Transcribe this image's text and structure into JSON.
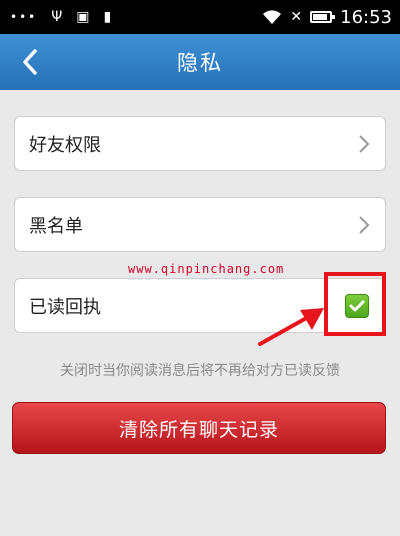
{
  "status_bar": {
    "time": "16:53",
    "icons": [
      "dots-icon",
      "usb-icon",
      "notification-icon",
      "sd-card-icon",
      "wifi-icon",
      "no-signal-icon",
      "battery-icon"
    ]
  },
  "header": {
    "title": "隐私",
    "back_icon": "chevron-left-icon"
  },
  "rows": [
    {
      "label": "好友权限",
      "trailing": "chevron-right-icon"
    },
    {
      "label": "黑名单",
      "trailing": "chevron-right-icon"
    },
    {
      "label": "已读回执",
      "trailing": "checkbox",
      "checked": true
    }
  ],
  "watermark": "www.qinpinchang.com",
  "hint": "关闭时当你阅读消息后将不再给对方已读反馈",
  "clear_button": {
    "label": "清除所有聊天记录"
  },
  "colors": {
    "header": "#2d7cc1",
    "checkbox": "#5cb82a",
    "button": "#c9252a",
    "annotation": "#e8141c"
  }
}
